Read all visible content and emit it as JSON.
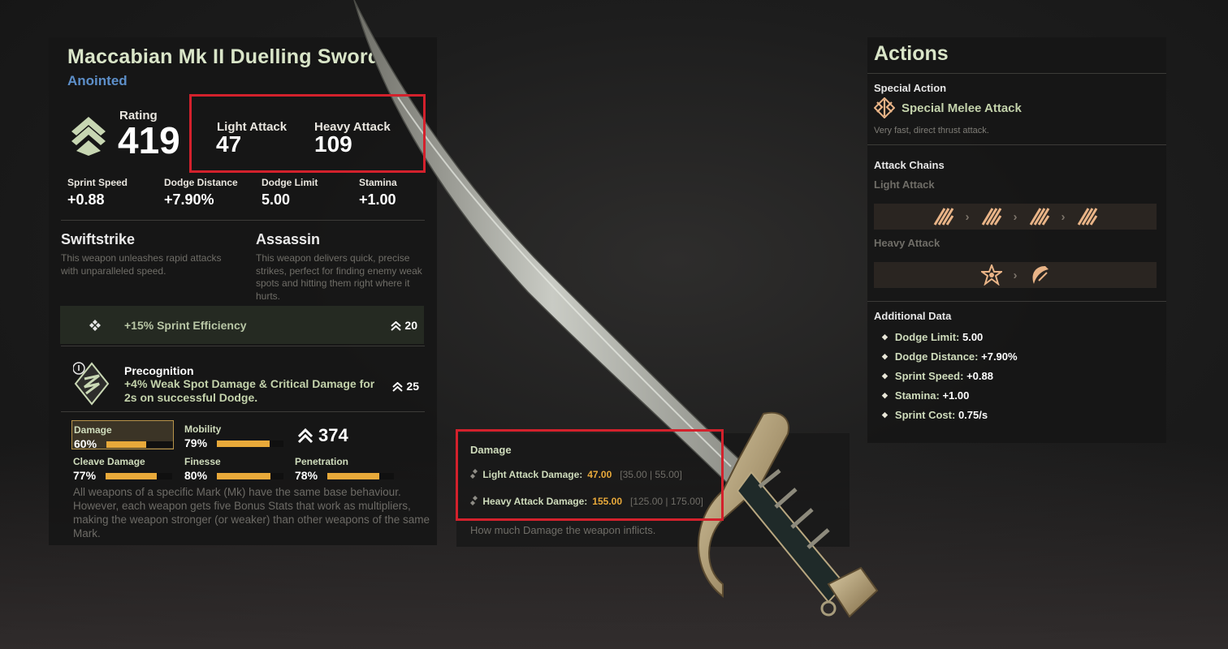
{
  "weapon": {
    "name": "Maccabian Mk II Duelling Sword",
    "tier": "Anointed",
    "rating_label": "Rating",
    "rating_value": "419",
    "light_attack_label": "Light Attack",
    "light_attack_value": "47",
    "heavy_attack_label": "Heavy Attack",
    "heavy_attack_value": "109"
  },
  "stats": [
    {
      "label": "Sprint Speed",
      "value": "+0.88"
    },
    {
      "label": "Dodge Distance",
      "value": "+7.90%"
    },
    {
      "label": "Dodge Limit",
      "value": "5.00"
    },
    {
      "label": "Stamina",
      "value": "+1.00"
    }
  ],
  "perks": [
    {
      "title": "Swiftstrike",
      "desc": "This weapon unleashes rapid attacks with unparalleled speed."
    },
    {
      "title": "Assassin",
      "desc": "This weapon delivers quick, precise strikes, perfect for finding enemy weak spots and hitting them right where it hurts."
    }
  ],
  "sprint_perk": {
    "text": "+15% Sprint Efficiency",
    "cost": "20",
    "icon": "diamond-cluster-icon"
  },
  "precognition": {
    "title": "Precognition",
    "desc": "+4% Weak Spot Damage & Critical Damage for 2s on successful Dodge.",
    "cost": "25",
    "icon": "precognition-rune-icon"
  },
  "bonus_stats": [
    {
      "label": "Damage",
      "value": "60%",
      "level": 0.6
    },
    {
      "label": "Mobility",
      "value": "79%",
      "level": 0.79
    },
    {
      "label": "Cleave Damage",
      "value": "77%",
      "level": 0.77
    },
    {
      "label": "Finesse",
      "value": "80%",
      "level": 0.8
    },
    {
      "label": "Penetration",
      "value": "78%",
      "level": 0.78
    }
  ],
  "bonus_total": "374",
  "bonus_desc": "All weapons of a specific Mark (Mk) have the same base behaviour. However, each weapon gets five Bonus Stats that work as multipliers, making the weapon stronger (or weaker) than other weapons of the same Mark.",
  "damage_panel": {
    "title": "Damage",
    "light_label": "Light Attack Damage:",
    "light_value": "47.00",
    "light_range": "[35.00 | 55.00]",
    "heavy_label": "Heavy Attack Damage:",
    "heavy_value": "155.00",
    "heavy_range": "[125.00 | 175.00]",
    "desc": "How much Damage the weapon inflicts."
  },
  "actions": {
    "title": "Actions",
    "special_label": "Special Action",
    "special_name": "Special Melee Attack",
    "special_desc": "Very fast, direct thrust attack.",
    "chains_label": "Attack Chains",
    "light_label": "Light Attack",
    "heavy_label": "Heavy Attack",
    "arrow": "›",
    "additional_label": "Additional Data",
    "additional": [
      {
        "label": "Dodge Limit:",
        "value": "5.00"
      },
      {
        "label": "Dodge Distance:",
        "value": "+7.90%"
      },
      {
        "label": "Sprint Speed:",
        "value": "+0.88"
      },
      {
        "label": "Stamina:",
        "value": "+1.00"
      },
      {
        "label": "Sprint Cost:",
        "value": "0.75/s"
      }
    ]
  },
  "colors": {
    "accent": "#e8a93a",
    "tier": "#5d8fc9",
    "highlight": "#d3212c",
    "title": "#d9e5c8"
  }
}
